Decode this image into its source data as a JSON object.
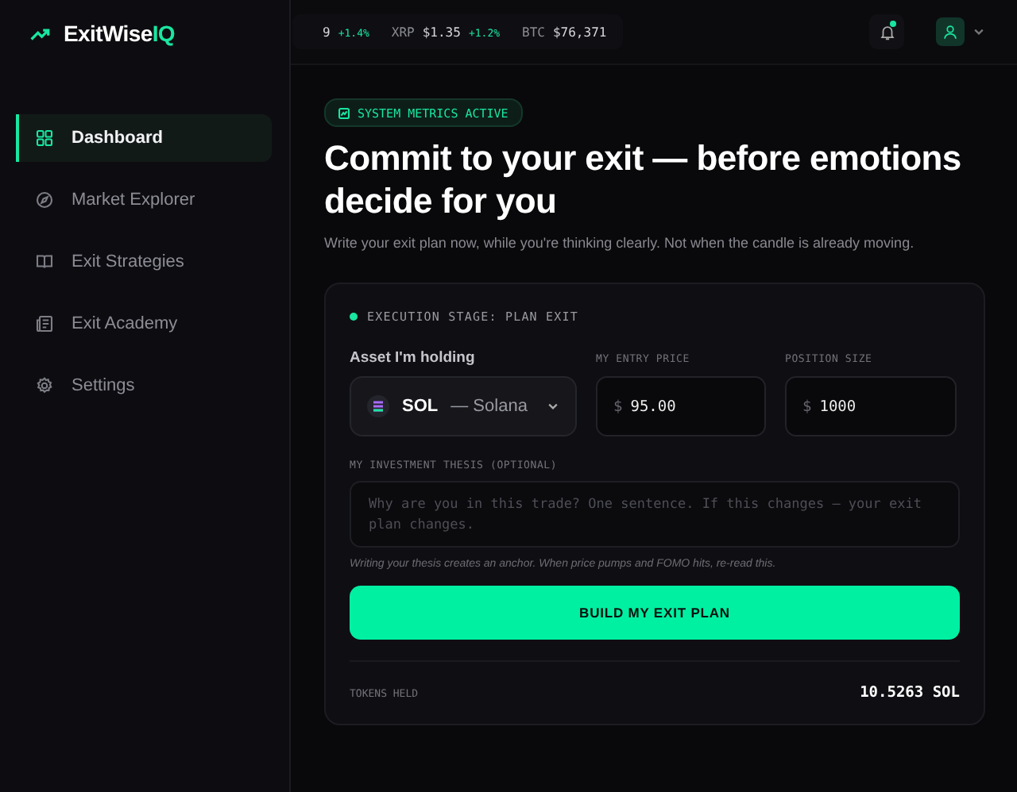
{
  "brand": {
    "name": "ExitWise",
    "accent": "IQ"
  },
  "ticker": [
    {
      "price": "9",
      "change": "+1.4%"
    },
    {
      "symbol": "XRP",
      "price": "$1.35",
      "change": "+1.2%"
    },
    {
      "symbol": "BTC",
      "price": "$76,371"
    }
  ],
  "notifications": {
    "unread": true
  },
  "sidebar": {
    "items": [
      {
        "label": "Dashboard",
        "selected": true
      },
      {
        "label": "Market Explorer",
        "selected": false
      },
      {
        "label": "Exit Strategies",
        "selected": false
      },
      {
        "label": "Exit Academy",
        "selected": false
      },
      {
        "label": "Settings",
        "selected": false
      }
    ]
  },
  "badge": "SYSTEM METRICS ACTIVE",
  "title": "Commit to your exit — before emotions decide for you",
  "subtitle": "Write your exit plan now, while you're thinking clearly. Not when the candle is already moving.",
  "card": {
    "stage": "EXECUTION STAGE: PLAN EXIT",
    "asset": {
      "label": "Asset I'm holding",
      "symbol": "SOL",
      "name": "— Solana"
    },
    "entry_price": {
      "label": "MY ENTRY PRICE",
      "currency": "$",
      "value": "95.00"
    },
    "position_size": {
      "label": "POSITION SIZE",
      "currency": "$",
      "value": "1000"
    },
    "thesis": {
      "label": "MY INVESTMENT THESIS (OPTIONAL)",
      "placeholder": "Why are you in this trade? One sentence. If this changes — your exit plan changes."
    },
    "hint": "Writing your thesis creates an anchor. When price pumps and FOMO hits, re-read this.",
    "button": "BUILD MY EXIT PLAN",
    "tokens": {
      "label": "TOKENS HELD",
      "value": "10.5263 SOL"
    }
  }
}
